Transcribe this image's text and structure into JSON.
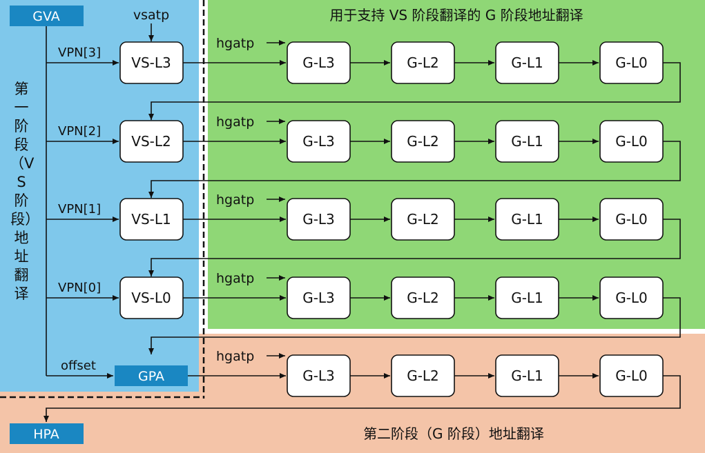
{
  "colors": {
    "stage1_bg": "#7fc8eb",
    "gstage_bg": "#8fd776",
    "stage2_bg": "#f4c4a8",
    "addr_box": "#1a87c2"
  },
  "labels": {
    "gva": "GVA",
    "gpa": "GPA",
    "hpa": "HPA",
    "vsatp": "vsatp",
    "hgatp": "hgatp",
    "offset": "offset",
    "vpn": [
      "VPN[3]",
      "VPN[2]",
      "VPN[1]",
      "VPN[0]"
    ],
    "vs_levels": [
      "VS-L3",
      "VS-L2",
      "VS-L1",
      "VS-L0"
    ],
    "g_levels": [
      "G-L3",
      "G-L2",
      "G-L1",
      "G-L0"
    ]
  },
  "regions": {
    "vs_stage_title": "第一阶段（VS 阶段）地址翻译",
    "g_for_vs_title": "用于支持 VS 阶段翻译的 G 阶段地址翻译",
    "g_stage_title": "第二阶段（G 阶段）地址翻译"
  }
}
